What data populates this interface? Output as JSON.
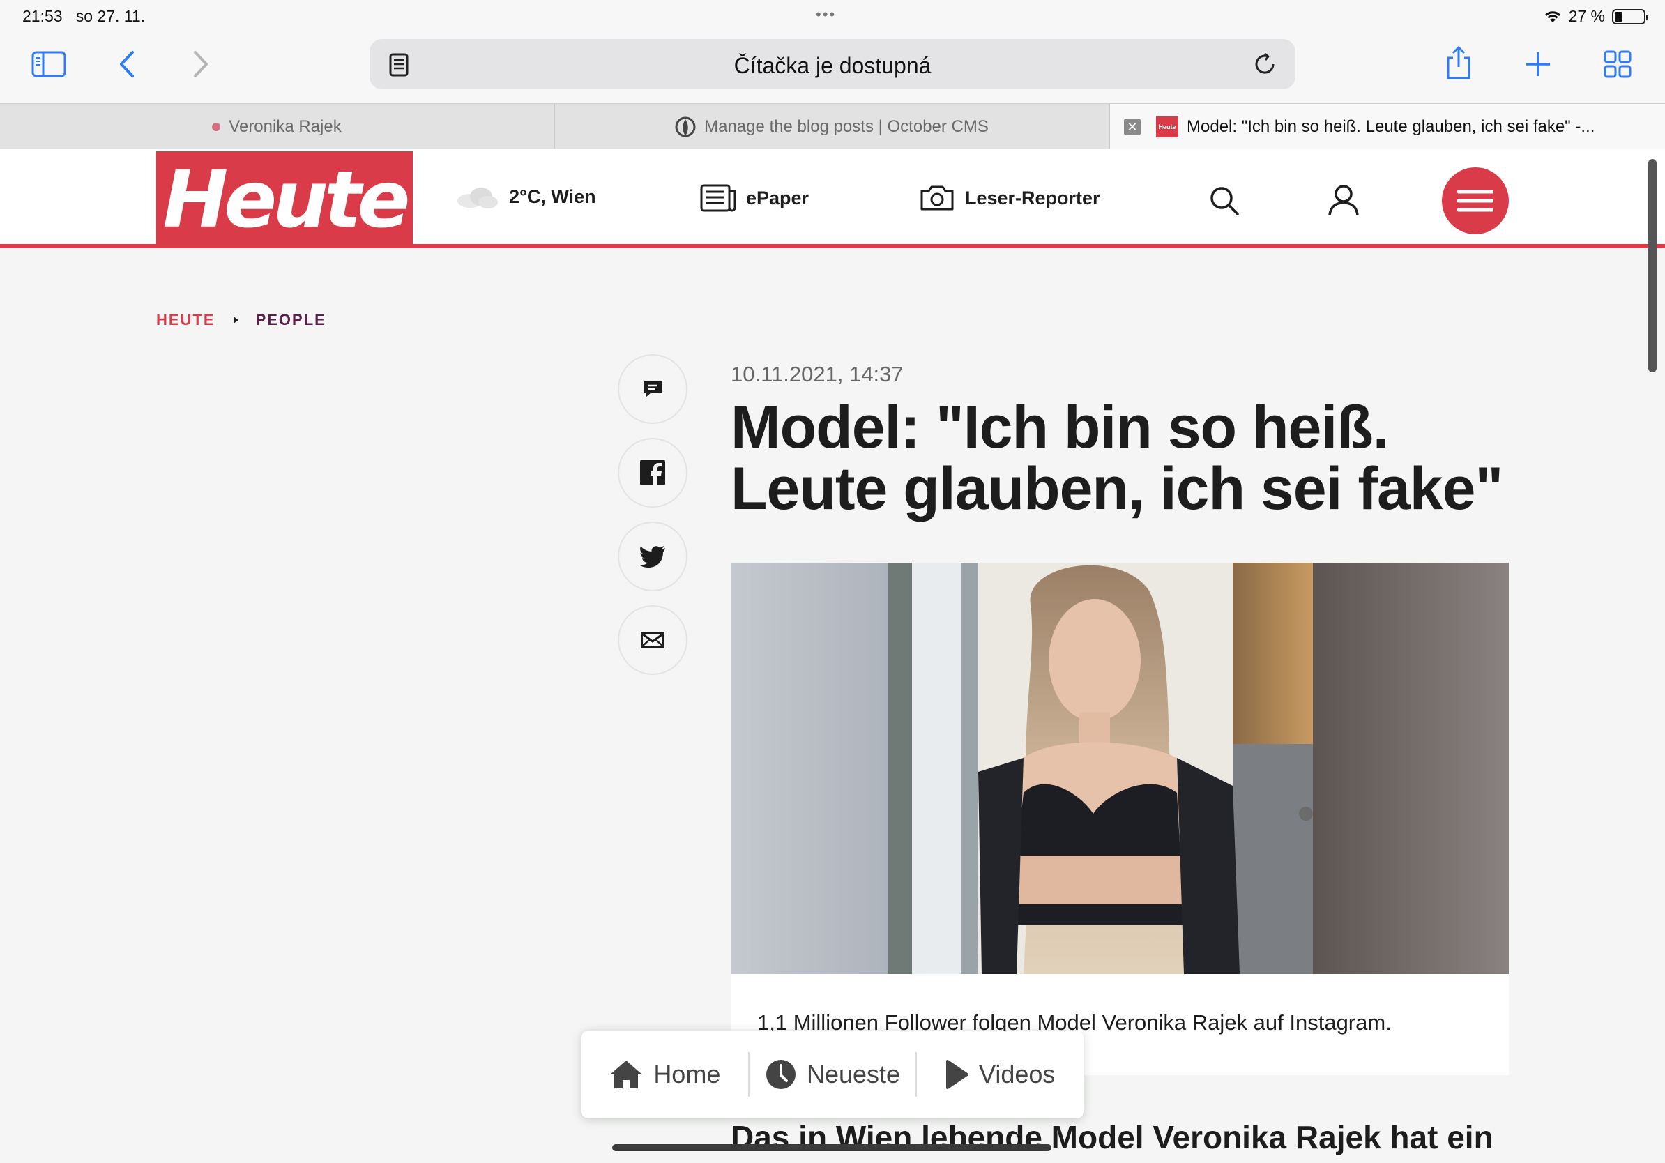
{
  "status": {
    "time": "21:53",
    "date": "so 27. 11.",
    "battery": "27 %",
    "battery_level": 0.27
  },
  "toolbar": {
    "address": "Čítačka je dostupná"
  },
  "tabs": [
    {
      "label": "Veronika Rajek"
    },
    {
      "label": "Manage the blog posts | October CMS"
    },
    {
      "label": "Model: \"Ich bin so heiß. Leute glauben, ich sei fake\" -..."
    }
  ],
  "site": {
    "logo": "Heute",
    "weather": "2°C, Wien",
    "epaper": "ePaper",
    "reporter": "Leser-Reporter",
    "accent": "#d93c48"
  },
  "breadcrumb": {
    "home": "HEUTE",
    "section": "PEOPLE"
  },
  "article": {
    "date": "10.11.2021, 14:37",
    "title": "Model: \"Ich bin so heiß. Leute glauben, ich sei fake\"",
    "caption": "1,1 Millionen Follower folgen Model Veronika Rajek auf Instagram.",
    "lead": "Das in Wien lebende Model Veronika Rajek hat ein"
  },
  "bottom_nav": {
    "home": "Home",
    "latest": "Neueste",
    "videos": "Videos"
  }
}
